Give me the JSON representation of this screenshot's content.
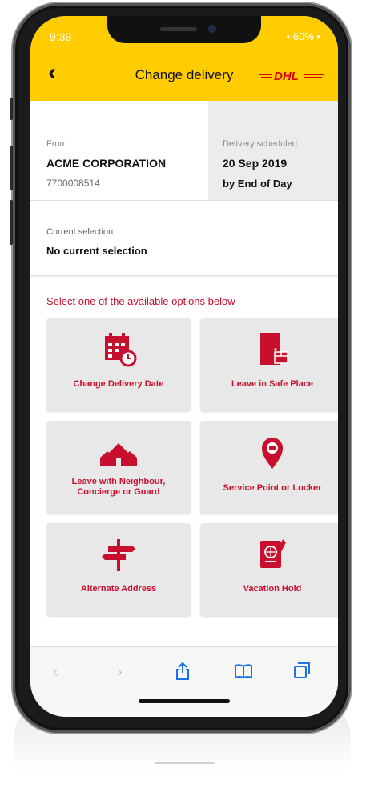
{
  "status": {
    "time": "9:39",
    "battery": "• 60% ▪"
  },
  "header": {
    "title": "Change delivery",
    "back_icon": "chevron-left-icon",
    "logo_text": "DHL"
  },
  "from": {
    "label": "From",
    "company": "ACME CORPORATION",
    "number": "7700008514"
  },
  "schedule": {
    "label": "Delivery scheduled",
    "date": "20 Sep 2019",
    "time": "by End of Day"
  },
  "current": {
    "label": "Current selection",
    "value": "No current selection"
  },
  "instruction": "Select one of the available options below",
  "options": [
    {
      "label": "Change Delivery Date",
      "icon": "calendar-clock-icon"
    },
    {
      "label": "Leave in Safe Place",
      "icon": "door-package-icon"
    },
    {
      "label": "Leave with Neighbour, Concierge or Guard",
      "icon": "houses-icon"
    },
    {
      "label": "Service Point or Locker",
      "icon": "location-pin-icon"
    },
    {
      "label": "Alternate Address",
      "icon": "signpost-icon"
    },
    {
      "label": "Vacation Hold",
      "icon": "passport-icon"
    }
  ],
  "colors": {
    "brand_yellow": "#ffcc00",
    "brand_red": "#c8102e",
    "ios_blue": "#1a73e8"
  },
  "toolbar": {
    "items": [
      "back-icon",
      "forward-icon",
      "share-icon",
      "bookmarks-icon",
      "tabs-icon"
    ]
  }
}
